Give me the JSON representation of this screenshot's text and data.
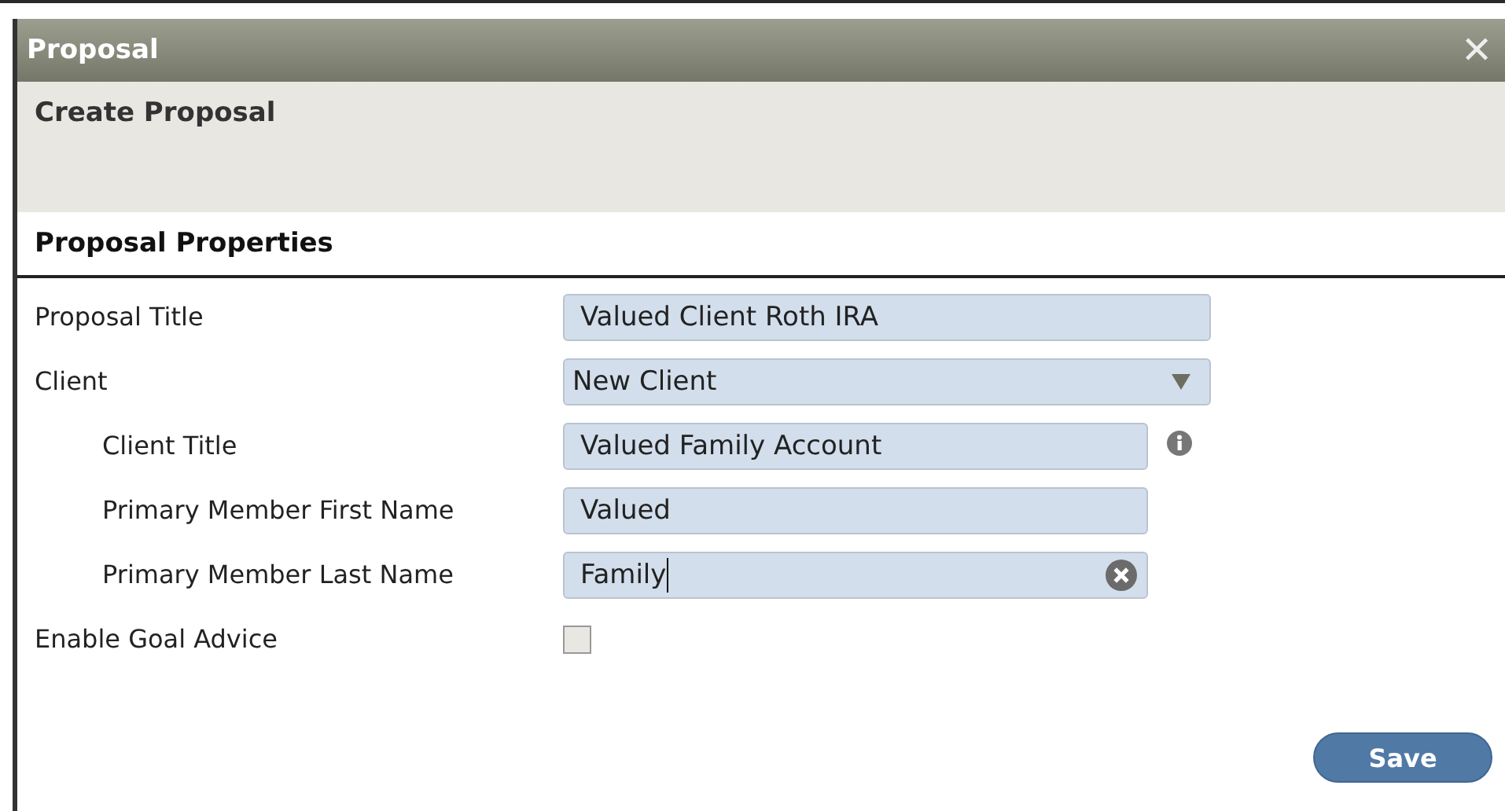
{
  "window": {
    "title": "Proposal",
    "close": "✕"
  },
  "header": {
    "title": "Create Proposal"
  },
  "section": {
    "title": "Proposal Properties"
  },
  "fields": [
    {
      "label": "Proposal Title",
      "kind": "text",
      "value": "Valued Client Roth IRA"
    },
    {
      "label": "Client",
      "kind": "select",
      "value": "New Client",
      "children": [
        {
          "label": "Client Title",
          "kind": "text",
          "value": "Valued Family Account",
          "info": true
        },
        {
          "label": "Primary Member First Name",
          "kind": "text",
          "value": "Valued"
        },
        {
          "label": "Primary Member Last Name",
          "kind": "text",
          "value": "Family",
          "focused": true,
          "clearable": true
        }
      ]
    },
    {
      "label": "Enable Goal Advice",
      "kind": "checkbox",
      "checked": false
    }
  ],
  "buttons": [
    {
      "label": "Save"
    }
  ]
}
